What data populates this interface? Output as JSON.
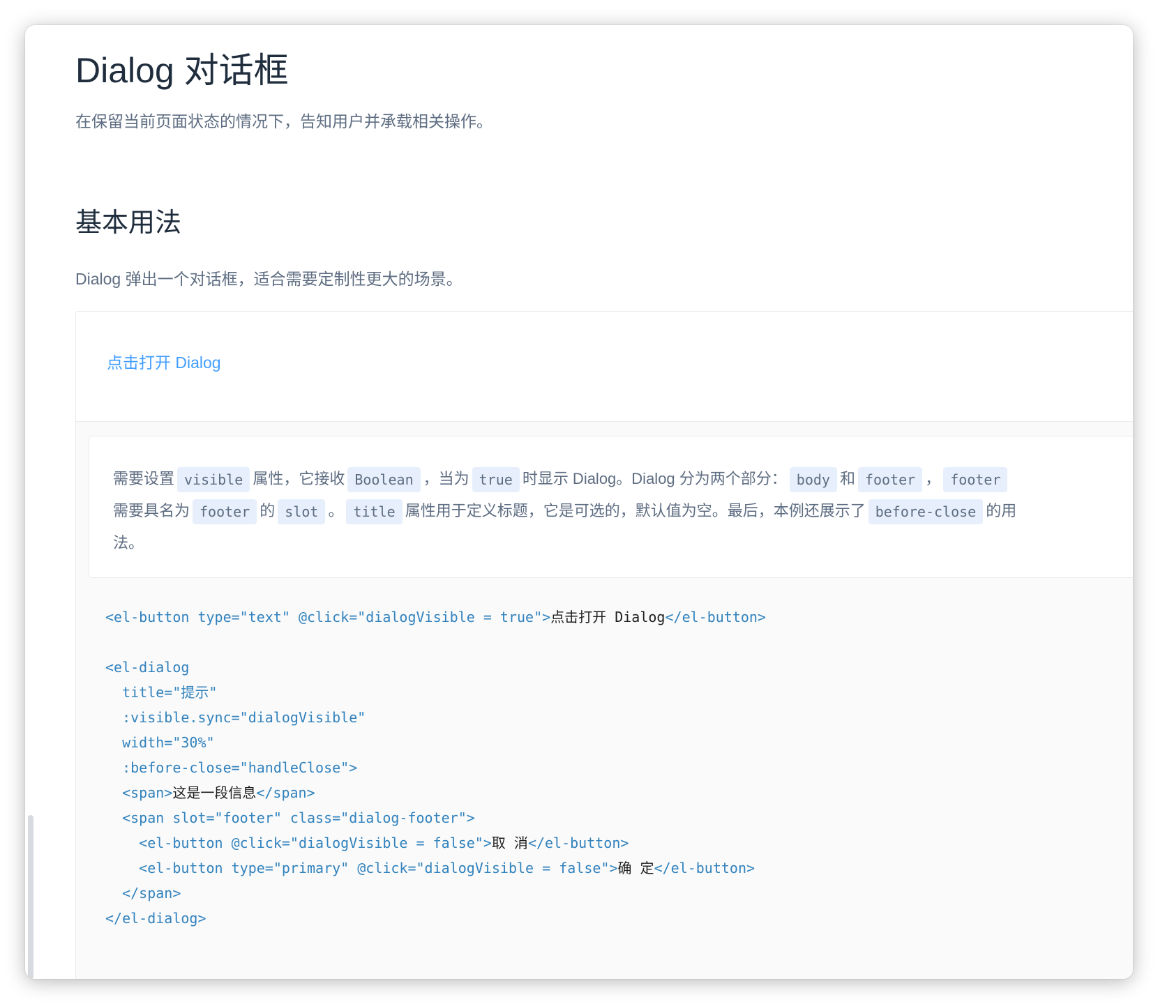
{
  "header": {
    "title": "Dialog 对话框",
    "description": "在保留当前页面状态的情况下，告知用户并承载相关操作。"
  },
  "section": {
    "title": "基本用法",
    "description": "Dialog 弹出一个对话框，适合需要定制性更大的场景。"
  },
  "demo": {
    "button_label": "点击打开 Dialog"
  },
  "meta_description": {
    "t1": "需要设置",
    "c1": "visible",
    "t2": "属性，它接收",
    "c2": "Boolean",
    "t3": "，当为",
    "c3": "true",
    "t4": "时显示 Dialog。Dialog 分为两个部分：",
    "c4": "body",
    "t5": "和",
    "c5": "footer",
    "t6": "，",
    "c6": "footer",
    "t7": "需要具名为",
    "c7": "footer",
    "t8": "的",
    "c8": "slot",
    "t9": "。",
    "c9": "title",
    "t10": "属性用于定义标题，它是可选的，默认值为空。最后，本例还展示了",
    "c10": "before-close",
    "t11": "的用法。"
  },
  "code": {
    "l1a": "<el-button type=\"text\" @click=\"dialogVisible = true\">",
    "l1b": "点击打开 Dialog",
    "l1c": "</el-button>",
    "l2": "",
    "l3": "<el-dialog",
    "l4": "  title=\"提示\"",
    "l5": "  :visible.sync=\"dialogVisible\"",
    "l6": "  width=\"30%\"",
    "l7": "  :before-close=\"handleClose\">",
    "l8a": "  <span>",
    "l8b": "这是一段信息",
    "l8c": "</span>",
    "l9": "  <span slot=\"footer\" class=\"dialog-footer\">",
    "l10a": "    <el-button @click=\"dialogVisible = false\">",
    "l10b": "取 消",
    "l10c": "</el-button>",
    "l11a": "    <el-button type=\"primary\" @click=\"dialogVisible = false\">",
    "l11b": "确 定",
    "l11c": "</el-button>",
    "l12": "  </span>",
    "l13": "</el-dialog>"
  },
  "colors": {
    "accent": "#409eff",
    "title": "#1f2d3d",
    "body_text": "#5e6d82",
    "code_tag": "#3182bd",
    "code_bg": "#fafafa",
    "inline_code_bg": "#e6effb"
  }
}
